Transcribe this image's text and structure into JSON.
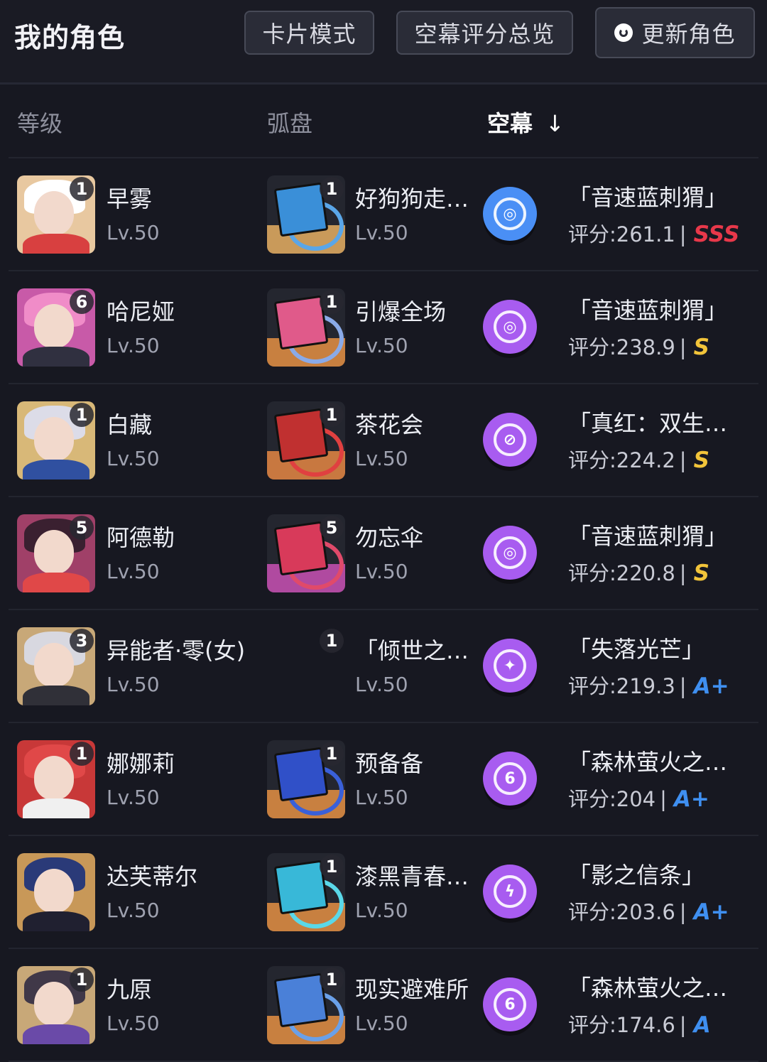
{
  "header": {
    "title": "我的角色",
    "card_mode": "卡片模式",
    "overview": "空幕评分总览",
    "refresh": "更新角色"
  },
  "columns": {
    "level": "等级",
    "disc": "弧盘",
    "kongmu": "空幕",
    "sort_arrow": "↓"
  },
  "colors": {
    "background": "#171821",
    "grade_SSS": "#e8384a",
    "grade_S": "#f2c43a",
    "grade_Aplus": "#3f8ff0",
    "grade_A": "#3f8ff0",
    "medal_purple": "#a85cf0",
    "medal_blue": "#4a8ff5"
  },
  "rows": [
    {
      "name": "早雾",
      "badge": "1",
      "level": "Lv.50",
      "disc": "好狗狗走…",
      "disc_badge": "1",
      "disc_level": "Lv.50",
      "set": "「音速蓝刺猬」",
      "score": "评分:261.1",
      "score_sep": "|",
      "grade": "SSS",
      "medal_symbol": "◎",
      "avatar_colors": [
        "#e8c8a0",
        "#ffffff",
        "#d84040"
      ],
      "disc_colors": [
        "#c99a5a",
        "#5aa6e8",
        "#3a8fd8"
      ]
    },
    {
      "name": "哈尼娅",
      "badge": "6",
      "level": "Lv.50",
      "disc": "引爆全场",
      "disc_badge": "1",
      "disc_level": "Lv.50",
      "set": "「音速蓝刺猬」",
      "score": "评分:238.9",
      "score_sep": "|",
      "grade": "S",
      "medal_symbol": "◎",
      "avatar_colors": [
        "#c85aa8",
        "#f08cc8",
        "#303040"
      ],
      "disc_colors": [
        "#c88040",
        "#8aaae8",
        "#e05a8a"
      ]
    },
    {
      "name": "白藏",
      "badge": "1",
      "level": "Lv.50",
      "disc": "茶花会",
      "disc_badge": "1",
      "disc_level": "Lv.50",
      "set": "「真红：双生…",
      "score": "评分:224.2",
      "score_sep": "|",
      "grade": "S",
      "medal_symbol": "⊘",
      "avatar_colors": [
        "#d8b878",
        "#dcdce8",
        "#3050a0"
      ],
      "disc_colors": [
        "#c87840",
        "#e04040",
        "#c03030"
      ]
    },
    {
      "name": "阿德勒",
      "badge": "5",
      "level": "Lv.50",
      "disc": "勿忘伞",
      "disc_badge": "5",
      "disc_level": "Lv.50",
      "set": "「音速蓝刺猬」",
      "score": "评分:220.8",
      "score_sep": "|",
      "grade": "S",
      "medal_symbol": "◎",
      "avatar_colors": [
        "#a04068",
        "#3a2030",
        "#e04848"
      ],
      "disc_colors": [
        "#b04aa0",
        "#e04a6a",
        "#d83a5a"
      ]
    },
    {
      "name": "异能者·零(女)",
      "badge": "3",
      "level": "Lv.50",
      "disc": "「倾世之…",
      "disc_badge": "1",
      "disc_level": "Lv.50",
      "set": "「失落光芒」",
      "score": "评分:219.3",
      "score_sep": "|",
      "grade": "A+",
      "medal_symbol": "✦",
      "avatar_colors": [
        "#c8a878",
        "#d8d8e0",
        "#303038"
      ],
      "disc_colors": [
        "transparent",
        "transparent",
        "transparent"
      ]
    },
    {
      "name": "娜娜莉",
      "badge": "1",
      "level": "Lv.50",
      "disc": "预备备",
      "disc_badge": "1",
      "disc_level": "Lv.50",
      "set": "「森林萤火之…",
      "score": "评分:204",
      "score_sep": "|",
      "grade": "A+",
      "medal_symbol": "6",
      "avatar_colors": [
        "#c83838",
        "#e04848",
        "#f0f0f0"
      ],
      "disc_colors": [
        "#c88040",
        "#3a60d8",
        "#3050c8"
      ]
    },
    {
      "name": "达芙蒂尔",
      "badge": "",
      "level": "Lv.50",
      "disc": "漆黑青春…",
      "disc_badge": "1",
      "disc_level": "Lv.50",
      "set": "「影之信条」",
      "score": "评分:203.6",
      "score_sep": "|",
      "grade": "A+",
      "medal_symbol": "ϟ",
      "avatar_colors": [
        "#c89858",
        "#2a3a78",
        "#202030"
      ],
      "disc_colors": [
        "#c88040",
        "#5ad8e8",
        "#38b8d8"
      ]
    },
    {
      "name": "九原",
      "badge": "1",
      "level": "Lv.50",
      "disc": "现实避难所",
      "disc_badge": "1",
      "disc_level": "Lv.50",
      "set": "「森林萤火之…",
      "score": "评分:174.6",
      "score_sep": "|",
      "grade": "A",
      "medal_symbol": "6",
      "avatar_colors": [
        "#c8a878",
        "#403848",
        "#6a4aa8"
      ],
      "disc_colors": [
        "#c88040",
        "#6aa0e8",
        "#4a80d8"
      ]
    }
  ]
}
